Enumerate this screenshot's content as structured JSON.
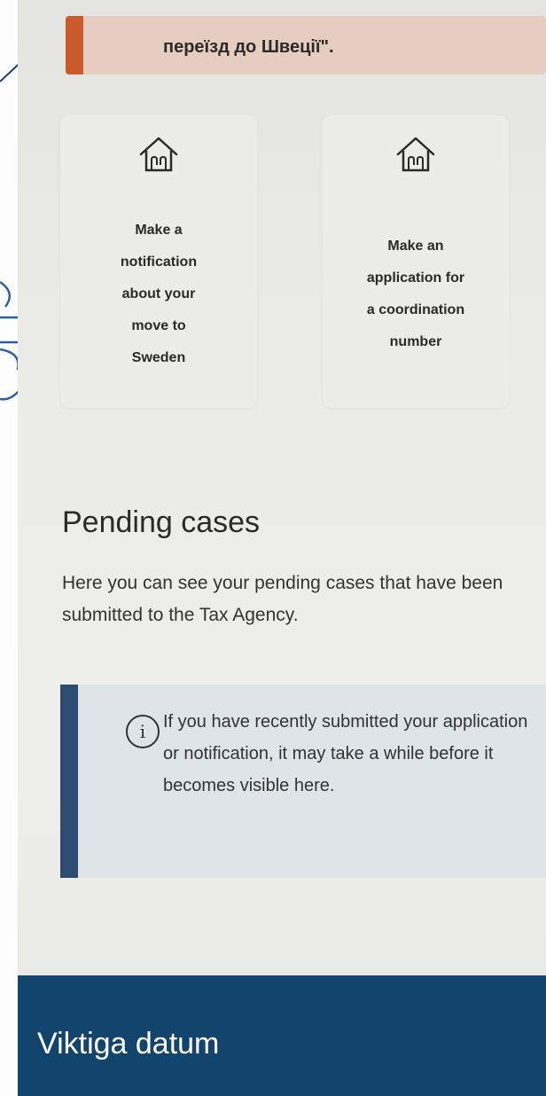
{
  "alert": {
    "text": "переїзд до Швеції\".",
    "accent_color": "#c95a2a"
  },
  "cards": [
    {
      "icon": "house-icon",
      "lines": [
        "Make a",
        "notification",
        "about your",
        "move to",
        "Sweden"
      ]
    },
    {
      "icon": "house-icon",
      "lines": [
        "Make an",
        "application for",
        "a coordination",
        "number"
      ]
    }
  ],
  "pending": {
    "title": "Pending cases",
    "description": "Here you can see your pending cases that have been submitted to the Tax Agency."
  },
  "info": {
    "icon": "info-icon",
    "icon_glyph": "i",
    "text": "If you have recently submitted your application or notification, it may take a while before it becomes visible here.",
    "accent_color": "#2c4d71"
  },
  "footer": {
    "title": "Viktiga datum",
    "background_color": "#12456e"
  }
}
